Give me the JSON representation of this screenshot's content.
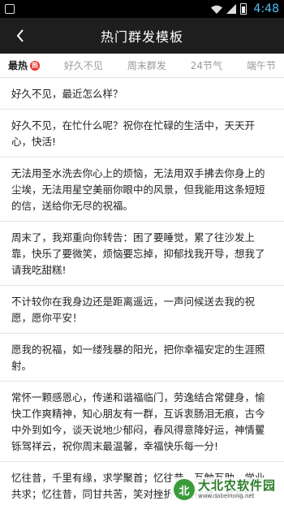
{
  "status": {
    "time": "4:48"
  },
  "header": {
    "title": "热门群发模板"
  },
  "tabs": [
    "最热",
    "好久不见",
    "周末群发",
    "24节气",
    "端午节"
  ],
  "hot_badge": "热",
  "items": [
    "好久不见，最近怎么样？",
    "好久不见，在忙什么呢？祝你在忙碌的生活中，天天开心，快活!",
    "无法用圣水洗去你心上的烦恼，无法用双手拂去你身上的尘埃，无法用星空美丽你眼中的风景，但我能用这条短短的信，送给你无尽的祝福。",
    "周末了，我郑重向你转告：困了要睡觉，累了往沙发上靠，快乐了要微笑，烦恼要忘掉，抑郁找我开导，想我了请我吃甜糕!",
    "不计较你在我身边还是距离遥远，一声问候送去我的祝愿，愿你平安！",
    "愿我的祝福，如一缕残暴的阳光，把你幸福安定的生涯照射。",
    "常怀一颗感恩心，传递和谐福临门，劳逸结合常健身，愉快工作爽精神，知心朋友有一群，互诉衷肠泪无痕，古今中外到如今，谈天说地少郁闷，春风得意降好运，神情矍铄驾祥云，祝你周末最温馨，幸福快乐每一分!",
    "忆往昔，千里有缘，求学聚首；忆往昔，互勉互助，学业共求；忆往昔，同甘共苦，笑对挫折；忆往昔，共享快乐，一起共荣；盼相见，再聚首，叙旧情！"
  ],
  "watermark": {
    "name": "大北农软件园",
    "url": "www.dabeinong.net",
    "logo_text": "北"
  }
}
